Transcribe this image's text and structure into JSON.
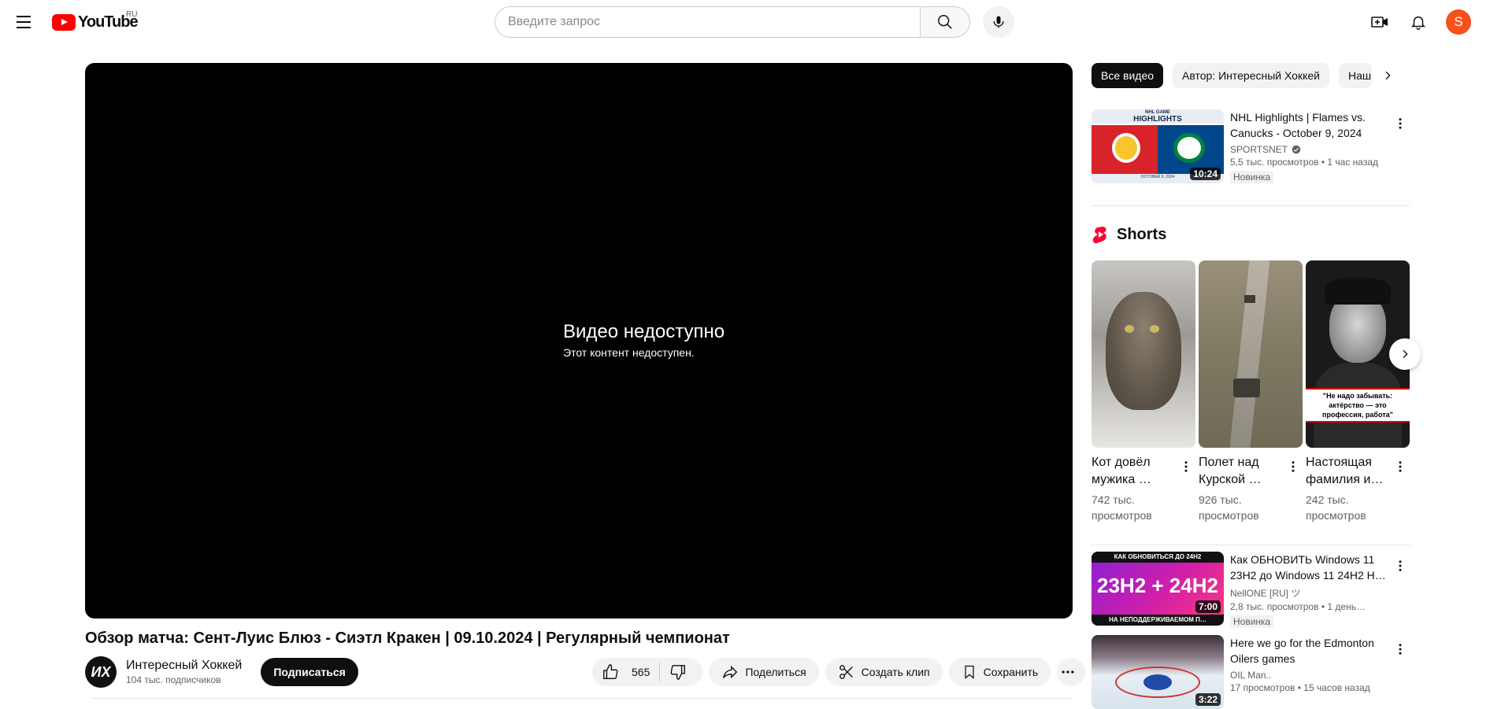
{
  "header": {
    "logo_text": "YouTube",
    "country": "RU",
    "search_placeholder": "Введите запрос",
    "avatar_letter": "S"
  },
  "player": {
    "message_title": "Видео недоступно",
    "message_sub": "Этот контент недоступен."
  },
  "video": {
    "title": "Обзор матча: Сент-Луис Блюз - Сиэтл Кракен | 09.10.2024 | Регулярный чемпионат",
    "channel_name": "Интересный Хоккей",
    "channel_initials": "ИХ",
    "subscribers": "104 тыс. подписчиков",
    "subscribe_label": "Подписаться",
    "like_count": "565",
    "share_label": "Поделиться",
    "clip_label": "Создать клип",
    "save_label": "Сохранить"
  },
  "sidebar": {
    "chips": [
      "Все видео",
      "Автор: Интересный Хоккей",
      "Наш"
    ],
    "videos": [
      {
        "title": "NHL Highlights | Flames vs. Canucks - October 9, 2024",
        "channel": "SPORTSNET",
        "stats": "5,5 тыс. просмотров • 1 час назад",
        "badge": "Новинка",
        "duration": "10:24",
        "thumb_text": "HIGHLIGHTS",
        "thumb_top": "NHL GAME",
        "thumb_date": "OCTOBER 9, 2024"
      },
      {
        "title": "Как ОБНОВИТЬ Windows 11 23H2 до Windows 11 24H2 Н…",
        "channel": "NellONE [RU] ツ",
        "stats": "2,8 тыс. просмотров • 1 день…",
        "badge": "Новинка",
        "duration": "7:00",
        "thumb_top": "КАК ОБНОВИТЬСЯ ДО 24H2",
        "thumb_text": "23H2 + 24H2",
        "thumb_bottom": "НА НЕПОДДЕРЖИВАЕМОМ П…"
      },
      {
        "title": "Here we go for the Edmonton Oilers games",
        "channel": "OIL Man..",
        "stats": "17 просмотров • 15 часов назад",
        "duration": "3:22"
      }
    ],
    "shorts_title": "Shorts",
    "shorts": [
      {
        "title": "Кот довёл мужика …",
        "views": "742 тыс. просмотров"
      },
      {
        "title": "Полет над Курской …",
        "views": "926 тыс. просмотров"
      },
      {
        "title": "Настоящая фамилия и…",
        "views": "242 тыс. просмотров",
        "caption": "\"Не надо забывать: актёрство — это профессия, работа\""
      }
    ]
  }
}
